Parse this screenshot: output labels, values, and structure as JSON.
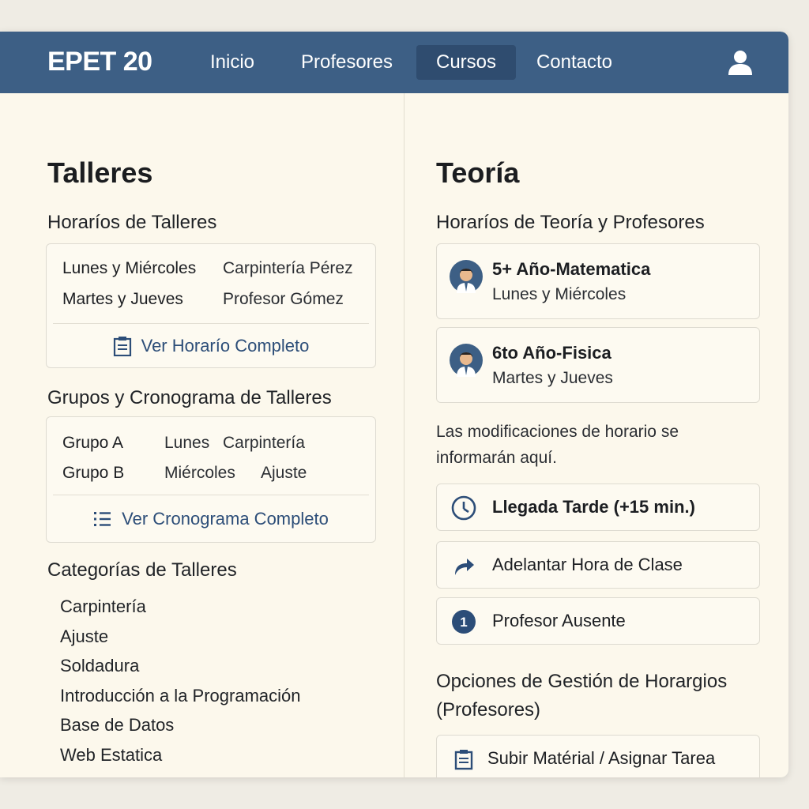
{
  "nav": {
    "brand": "EPET 20",
    "items": [
      "Inicio",
      "Profesores",
      "Cursos",
      "Contacto"
    ],
    "active": "Cursos"
  },
  "talleres": {
    "title": "Talleres",
    "horarios": {
      "title": "Horaríos de Talleres",
      "rows": [
        {
          "day": "Lunes y Miércoles",
          "detail": "Carpintería Pérez"
        },
        {
          "day": "Martes y Jueves",
          "detail": "Profesor Gómez"
        }
      ],
      "link": "Ver Horarío Completo"
    },
    "grupos": {
      "title": "Grupos y Cronograma de Talleres",
      "rows": [
        {
          "group": "Grupo A",
          "day": "Lunes",
          "detail": "Carpintería"
        },
        {
          "group": "Grupo B",
          "day": "Miércoles",
          "detail": "Ajuste"
        }
      ],
      "link": "Ver Cronograma Completo"
    },
    "categorias": {
      "title": "Categorías de Talleres",
      "items": [
        "Carpintería",
        "Ajuste",
        "Soldadura",
        "Introducción a la Programación",
        "Base de Datos",
        "Web Estatica"
      ]
    }
  },
  "teoria": {
    "title": "Teoría",
    "subtitle": "Horaríos de Teoría y Profesores",
    "professors": [
      {
        "title": "5+ Año-Matematica",
        "schedule": "Lunes y Miércoles"
      },
      {
        "title": "6to Año-Fisica",
        "schedule": "Martes y Jueves"
      }
    ],
    "notice": "Las modificaciones de horario se informarán aquí.",
    "actions": [
      {
        "label": "Llegada Tarde (+15 min.)",
        "icon": "clock-icon"
      },
      {
        "label": "Adelantar Hora de Clase",
        "icon": "forward-arrow-icon"
      },
      {
        "label": "Profesor Ausente",
        "icon": "number-one-icon"
      }
    ],
    "gestion": {
      "title": "Opciones de Gestión de Horargios (Profesores)",
      "button": "Subir Matérial / Asignar Tarea"
    }
  },
  "colors": {
    "navbar": "#3d5f85",
    "navbar_active": "#2f4c6f",
    "accent_link": "#2c4d78",
    "background": "#fcf8ec"
  }
}
